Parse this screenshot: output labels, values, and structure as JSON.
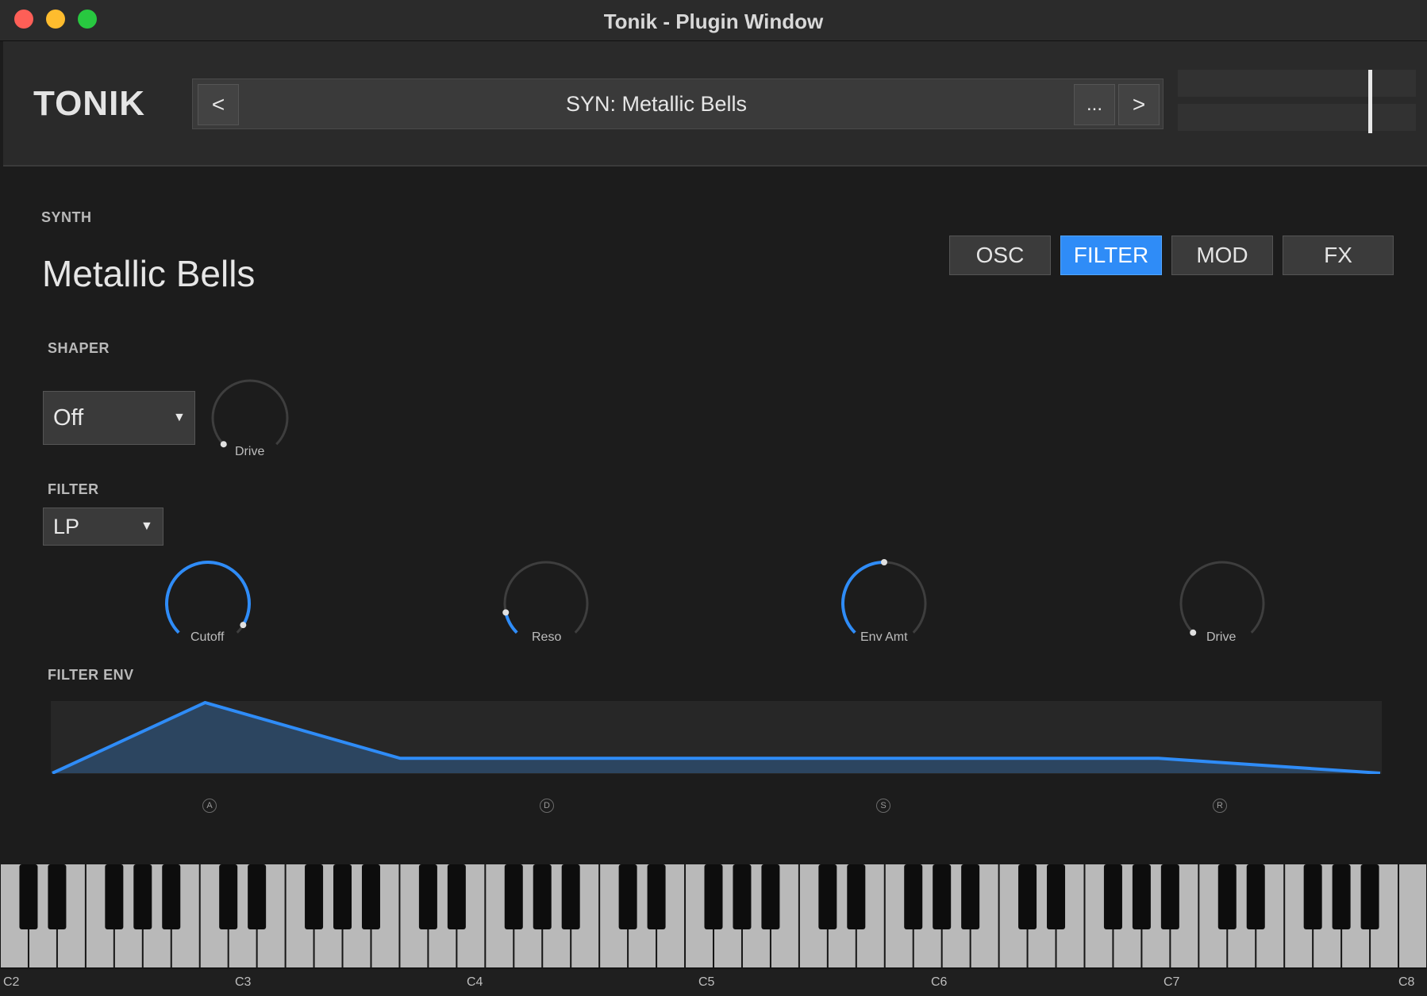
{
  "window": {
    "title": "Tonik - Plugin Window"
  },
  "header": {
    "logo": "TONIK",
    "preset": {
      "prev_label": "<",
      "name": "SYN: Metallic Bells",
      "more_label": "...",
      "next_label": ">"
    }
  },
  "main": {
    "category": "SYNTH",
    "patch_name": "Metallic Bells",
    "tabs": [
      {
        "label": "OSC",
        "active": false
      },
      {
        "label": "FILTER",
        "active": true
      },
      {
        "label": "MOD",
        "active": false
      },
      {
        "label": "FX",
        "active": false
      }
    ],
    "shaper": {
      "label": "SHAPER",
      "type": "Off",
      "drive_label": "Drive",
      "drive_value": 0.0
    },
    "filter": {
      "label": "FILTER",
      "type": "LP",
      "knobs": [
        {
          "label": "Cutoff",
          "value": 0.95
        },
        {
          "label": "Reso",
          "value": 0.12
        },
        {
          "label": "Env Amt",
          "value": 0.5
        },
        {
          "label": "Drive",
          "value": 0.0
        }
      ]
    },
    "filter_env": {
      "label": "FILTER ENV",
      "points": [
        {
          "t": 0.0,
          "level": 0.0
        },
        {
          "t": 0.115,
          "level": 1.0
        },
        {
          "t": 0.262,
          "level": 0.21
        },
        {
          "t": 0.833,
          "level": 0.21
        },
        {
          "t": 1.0,
          "level": 0.0
        }
      ],
      "handles": [
        "A",
        "D",
        "S",
        "R"
      ]
    }
  },
  "keyboard": {
    "octave_labels": [
      "C2",
      "C3",
      "C4",
      "C5",
      "C6",
      "C7",
      "C8"
    ]
  },
  "colors": {
    "accent": "#2f8cf7",
    "background": "#1c1c1c",
    "header": "#2a2a2a",
    "white_key": "#b9b9b9",
    "black_key": "#0d0d0d"
  }
}
